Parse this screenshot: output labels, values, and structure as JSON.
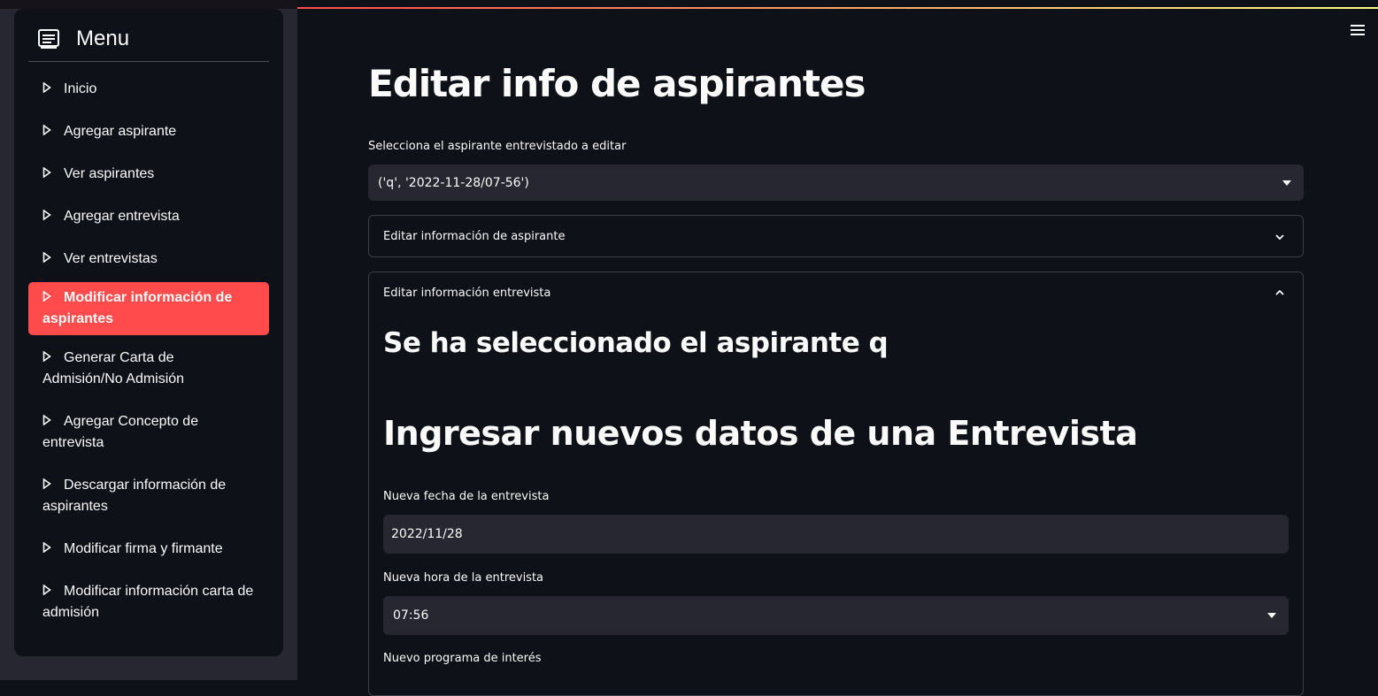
{
  "sidebar": {
    "title": "Menu",
    "items": [
      {
        "label": "Inicio"
      },
      {
        "label": "Agregar aspirante"
      },
      {
        "label": "Ver aspirantes"
      },
      {
        "label": "Agregar entrevista"
      },
      {
        "label": "Ver entrevistas"
      },
      {
        "label": "Modificar información de aspirantes",
        "active": true
      },
      {
        "label": "Generar Carta de Admisión/No Admisión"
      },
      {
        "label": "Agregar Concepto de entrevista"
      },
      {
        "label": "Descargar información de aspirantes"
      },
      {
        "label": "Modificar firma y firmante"
      },
      {
        "label": "Modificar información carta de admisión"
      }
    ]
  },
  "main": {
    "title": "Editar info de aspirantes",
    "select_label": "Selecciona el aspirante entrevistado a editar",
    "select_value": "('q', '2022-11-28/07-56')",
    "expander1": {
      "label": "Editar información de aspirante"
    },
    "expander2": {
      "label": "Editar información entrevista",
      "selected_heading": "Se ha seleccionado el aspirante q",
      "new_data_heading": "Ingresar nuevos datos de una Entrevista",
      "date_label": "Nueva fecha de la entrevista",
      "date_value": "2022/11/28",
      "time_label": "Nueva hora de la entrevista",
      "time_value": "07:56",
      "program_label": "Nuevo programa de interés"
    }
  },
  "colors": {
    "accent": "#ff4b4b",
    "background": "#0e1117",
    "sidebar": "#262730",
    "input": "#262730"
  }
}
